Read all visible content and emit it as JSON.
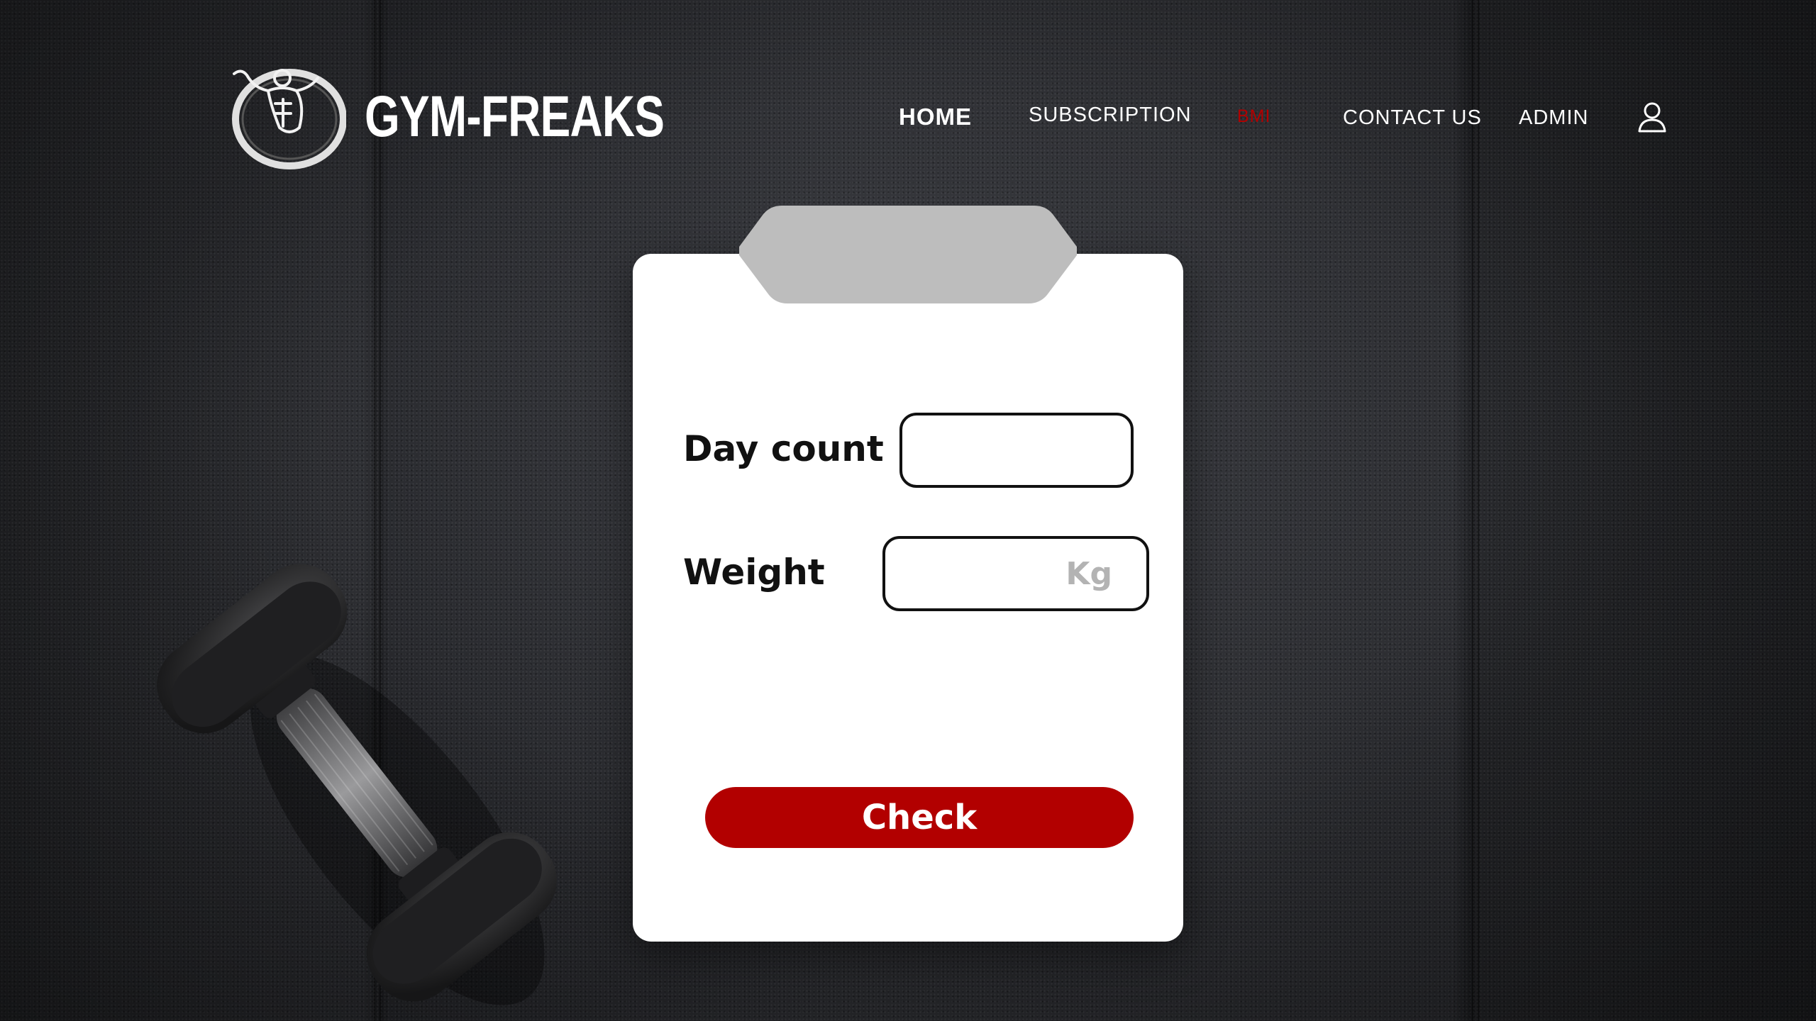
{
  "brand": {
    "name": "GYM-FREAKS"
  },
  "nav": {
    "items": [
      {
        "label": "HOME"
      },
      {
        "label": "SUBSCRIPTION"
      },
      {
        "label": "BMI"
      },
      {
        "label": "CONTACT US"
      },
      {
        "label": "ADMIN"
      }
    ],
    "active_color": "#b30000"
  },
  "form": {
    "day_count": {
      "label": "Day count",
      "value": "",
      "placeholder": ""
    },
    "weight": {
      "label": "Weight",
      "value": "",
      "placeholder": "Kg"
    },
    "submit_label": "Check"
  },
  "colors": {
    "accent": "#b20000",
    "card": "#ffffff",
    "clip": "#bdbdbd",
    "background": "#2a2b2f"
  },
  "icons": {
    "logo": "bodybuilder-emblem-icon",
    "user": "user-icon"
  }
}
